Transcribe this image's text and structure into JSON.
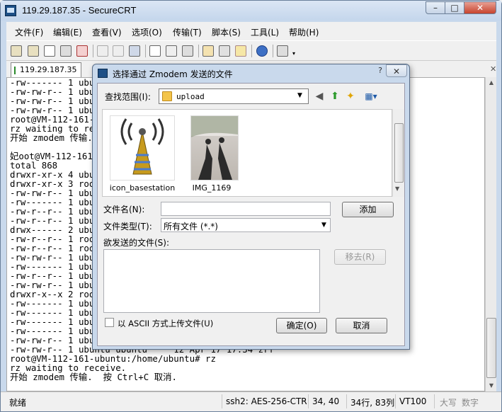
{
  "window": {
    "title": "119.29.187.35 - SecureCRT",
    "min": "–",
    "max": "□",
    "close": "✕"
  },
  "menu": [
    "文件(F)",
    "编辑(E)",
    "查看(V)",
    "选项(O)",
    "传输(T)",
    "脚本(S)",
    "工具(L)",
    "帮助(H)"
  ],
  "tab": {
    "label": "119.29.187.35",
    "close": "✕"
  },
  "terminal": {
    "lines": [
      "-rw------- 1 ubuntu ubuntu",
      "-rw-rw-r-- 1 ubuntu ubuntu",
      "-rw-rw-r-- 1 ubuntu ubuntu",
      "-rw-rw-r-- 1 ubuntu ubuntu",
      "root@VM-112-161-ubuntu:/home/ubuntu# rz",
      "rz waiting to receive.",
      "开始 zmodem 传输.  按 Ctrl+C 取消.",
      "",
      "妃oot@VM-112-161-ubuntu:/home/ubuntu# ll",
      "total 868",
      "drwxr-xr-x 4 ubuntu ubuntu",
      "drwxr-xr-x 3 root   root",
      "-rw-rw-r-- 1 ubuntu ubuntu",
      "-rw------- 1 ubuntu ubuntu",
      "-rw-r--r-- 1 ubuntu ubuntu",
      "-rw-r--r-- 1 ubuntu ubuntu",
      "drwx------ 2 ubuntu ubuntu",
      "-rw-r--r-- 1 root   root",
      "-rw-r--r-- 1 root   root",
      "-rw-rw-r-- 1 ubuntu ubuntu",
      "-rw------- 1 ubuntu ubuntu",
      "-rw-r--r-- 1 ubuntu ubuntu",
      "-rw-rw-r-- 1 ubuntu ubuntu",
      "drwxr-x--x 2 root   root",
      "-rw------- 1 ubuntu ubuntu",
      "-rw------- 1 ubuntu ubuntu",
      "-rw------- 1 ubuntu ubuntu",
      "-rw------- 1 ubuntu ubuntu",
      "-rw-rw-r-- 1 ubuntu ubuntu",
      "-rw-rw-r-- 1 ubuntu ubuntu     12 Apr 17 17:34 zrf",
      "root@VM-112-161-ubuntu:/home/ubuntu# rz",
      "rz waiting to receive.",
      "开始 zmodem 传输.  按 Ctrl+C 取消."
    ]
  },
  "status": {
    "ready": "就绪",
    "cipher": "ssh2: AES-256-CTR",
    "cursor": "34,  40",
    "size": "34行, 83列",
    "term": "VT100",
    "caps": "大写",
    "num": "数字"
  },
  "dialog": {
    "title": "选择通过 Zmodem 发送的文件",
    "help": "?",
    "close": "✕",
    "lookin_label": "查找范围(I):",
    "lookin_value": "upload",
    "files": [
      {
        "name": "icon_basestation",
        "icon": "antenna-icon"
      },
      {
        "name": "IMG_1169",
        "icon": "photo-thumbnail"
      }
    ],
    "filename_label": "文件名(N):",
    "filename_value": "",
    "add_button": "添加",
    "filetype_label": "文件类型(T):",
    "filetype_value": "所有文件 (*.*)",
    "send_list_label": "欲发送的文件(S):",
    "remove_button": "移去(R)",
    "ascii_label": "以 ASCII 方式上传文件(U)",
    "ok_button": "确定(O)",
    "cancel_button": "取消"
  }
}
